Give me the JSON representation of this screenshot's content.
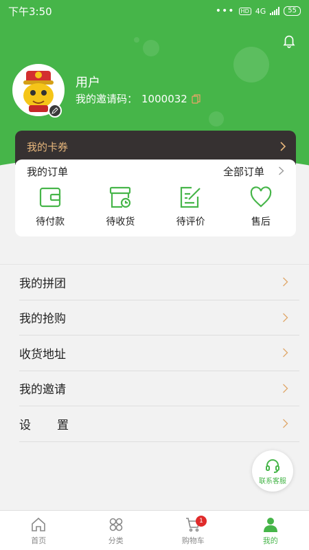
{
  "status_bar": {
    "time": "下午3:50",
    "network": "4G",
    "battery": "55"
  },
  "profile": {
    "username": "用户",
    "invite_label": "我的邀请码：",
    "invite_code": "1000032"
  },
  "card_strip": {
    "label": "我的卡券"
  },
  "orders": {
    "title": "我的订单",
    "all_label": "全部订单",
    "items": [
      {
        "label": "待付款",
        "icon": "wallet-icon"
      },
      {
        "label": "待收货",
        "icon": "delivery-clock-icon"
      },
      {
        "label": "待评价",
        "icon": "edit-review-icon"
      },
      {
        "label": "售后",
        "icon": "heart-icon"
      }
    ]
  },
  "menu": {
    "items": [
      {
        "label": "我的拼团"
      },
      {
        "label": "我的抢购"
      },
      {
        "label": "收货地址"
      },
      {
        "label": "我的邀请"
      },
      {
        "label": "设置"
      }
    ]
  },
  "service": {
    "label": "联系客服"
  },
  "bottom_nav": {
    "items": [
      {
        "label": "首页",
        "icon": "home-icon"
      },
      {
        "label": "分类",
        "icon": "category-icon"
      },
      {
        "label": "购物车",
        "icon": "cart-icon",
        "badge": "1"
      },
      {
        "label": "我的",
        "icon": "user-icon",
        "active": true
      }
    ]
  },
  "colors": {
    "accent": "#46b549",
    "card_dark": "#363131",
    "card_text": "#e8b77c",
    "badge": "#e02b2b",
    "chevron": "#e0a96d"
  }
}
